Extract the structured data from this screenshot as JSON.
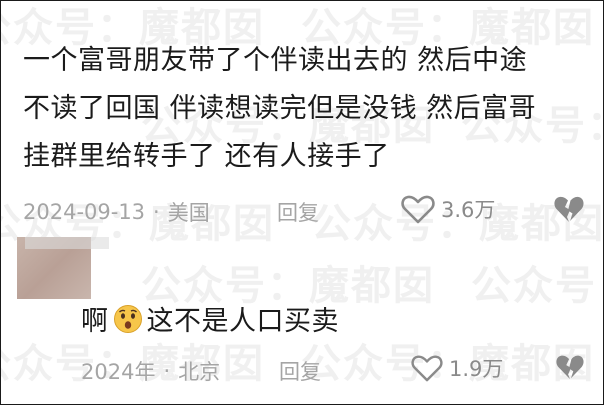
{
  "watermark": {
    "text": "公众号：魔都囡"
  },
  "comment1": {
    "lines": [
      "一个富哥朋友带了个伴读出去的 然后中途",
      "不读了回国 伴读想读完但是没钱 然后富哥",
      "挂群里给转手了 还有人接手了"
    ],
    "date": "2024-09-13",
    "separator": "·",
    "location": "美国",
    "reply_label": "回复",
    "like_count": "3.6万"
  },
  "comment2": {
    "text_before": "啊",
    "emoji": "surprised-face",
    "text_after": "这不是人口买卖",
    "date": "2024年",
    "separator": "·",
    "location": "北京",
    "reply_label": "回复",
    "like_count": "1.9万"
  },
  "colors": {
    "text": "#1b1b1b",
    "meta": "#a5a5a5",
    "icon": "#8a8a8a",
    "avatar": "#c8b4aa"
  }
}
